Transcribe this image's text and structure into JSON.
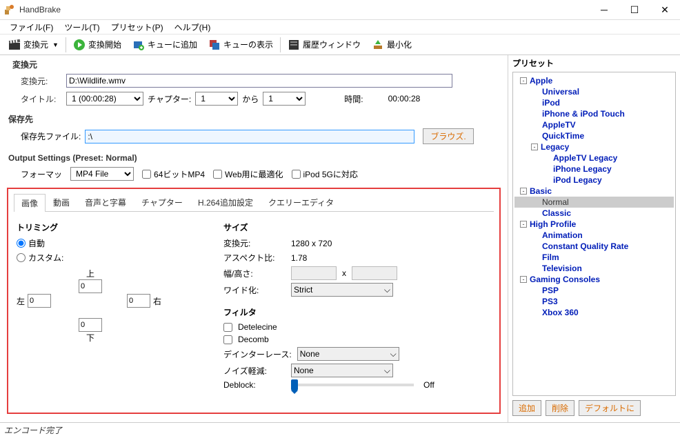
{
  "titlebar": {
    "title": "HandBrake"
  },
  "menu": {
    "file": "ファイル(F)",
    "tool": "ツール(T)",
    "preset": "プリセット(P)",
    "help": "ヘルプ(H)"
  },
  "toolbar": {
    "source": "変換元",
    "start": "変換開始",
    "addqueue": "キューに追加",
    "showqueue": "キューの表示",
    "history": "履歴ウィンドウ",
    "minimize": "最小化"
  },
  "source": {
    "group": "変換元",
    "label": "変換元:",
    "path": "D:\\Wildlife.wmv",
    "title_label": "タイトル:",
    "title_value": "1 (00:00:28)",
    "chapter_label": "チャプター:",
    "ch_from": "1",
    "ch_sep": "から",
    "ch_to": "1",
    "time_label": "時間:",
    "time_value": "00:00:28"
  },
  "dest": {
    "group": "保存先",
    "label": "保存先ファイル:",
    "path": ":\\",
    "browse": "ブラウズ."
  },
  "output": {
    "group": "Output Settings (Preset: Normal)",
    "format_label": "フォーマッ",
    "format_value": "MP4 File",
    "large": "64ビットMP4",
    "web": "Web用に最適化",
    "ipod": "iPod 5Gに対応"
  },
  "tabs": {
    "image": "画像",
    "video": "動画",
    "audio": "音声と字幕",
    "chapter": "チャプター",
    "h264": "H.264追加設定",
    "query": "クエリーエディタ"
  },
  "crop": {
    "title": "トリミング",
    "auto": "自動",
    "custom": "カスタム:",
    "top": "上",
    "bottom": "下",
    "left": "左",
    "right": "右",
    "v": "0"
  },
  "size": {
    "title": "サイズ",
    "src_label": "変換元:",
    "src_val": "1280 x 720",
    "aspect_label": "アスペクト比:",
    "aspect_val": "1.78",
    "wh_label": "幅/高さ:",
    "x": "x",
    "wide_label": "ワイド化:",
    "wide_val": "Strict"
  },
  "filter": {
    "title": "フィルタ",
    "detelecine": "Detelecine",
    "decomb": "Decomb",
    "deint_label": "デインターレース:",
    "deint_val": "None",
    "noise_label": "ノイズ軽減:",
    "noise_val": "None",
    "deblock_label": "Deblock:",
    "off": "Off"
  },
  "presets": {
    "title": "プリセット",
    "apple": "Apple",
    "apple_items": [
      "Universal",
      "iPod",
      "iPhone & iPod Touch",
      "AppleTV",
      "QuickTime"
    ],
    "legacy": "Legacy",
    "legacy_items": [
      "AppleTV Legacy",
      "iPhone Legacy",
      "iPod Legacy"
    ],
    "basic": "Basic",
    "basic_items": [
      "Normal",
      "Classic"
    ],
    "high": "High Profile",
    "high_items": [
      "Animation",
      "Constant Quality Rate",
      "Film",
      "Television"
    ],
    "gaming": "Gaming Consoles",
    "gaming_items": [
      "PSP",
      "PS3",
      "Xbox 360"
    ],
    "btn_add": "追加",
    "btn_del": "削除",
    "btn_def": "デフォルトに"
  },
  "status": "エンコード完了"
}
